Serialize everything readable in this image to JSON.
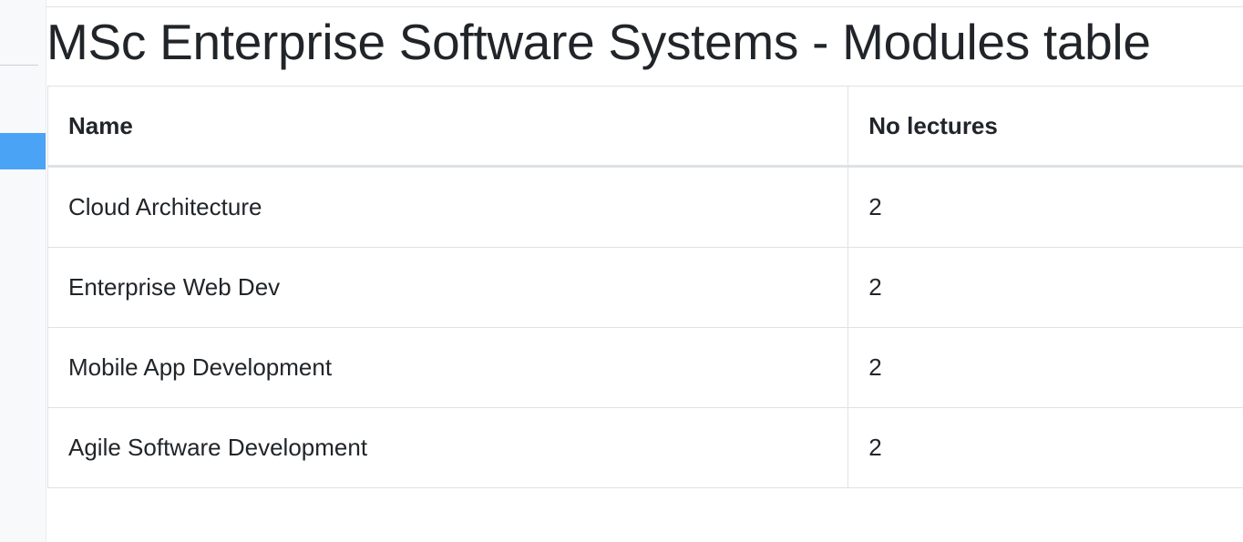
{
  "page": {
    "title": "MSc Enterprise Software Systems - Modules table"
  },
  "table": {
    "headers": [
      "Name",
      "No lectures"
    ],
    "rows": [
      {
        "name": "Cloud Architecture",
        "lectures": "2"
      },
      {
        "name": "Enterprise Web Dev",
        "lectures": "2"
      },
      {
        "name": "Mobile App Development",
        "lectures": "2"
      },
      {
        "name": "Agile Software Development",
        "lectures": "2"
      }
    ]
  }
}
